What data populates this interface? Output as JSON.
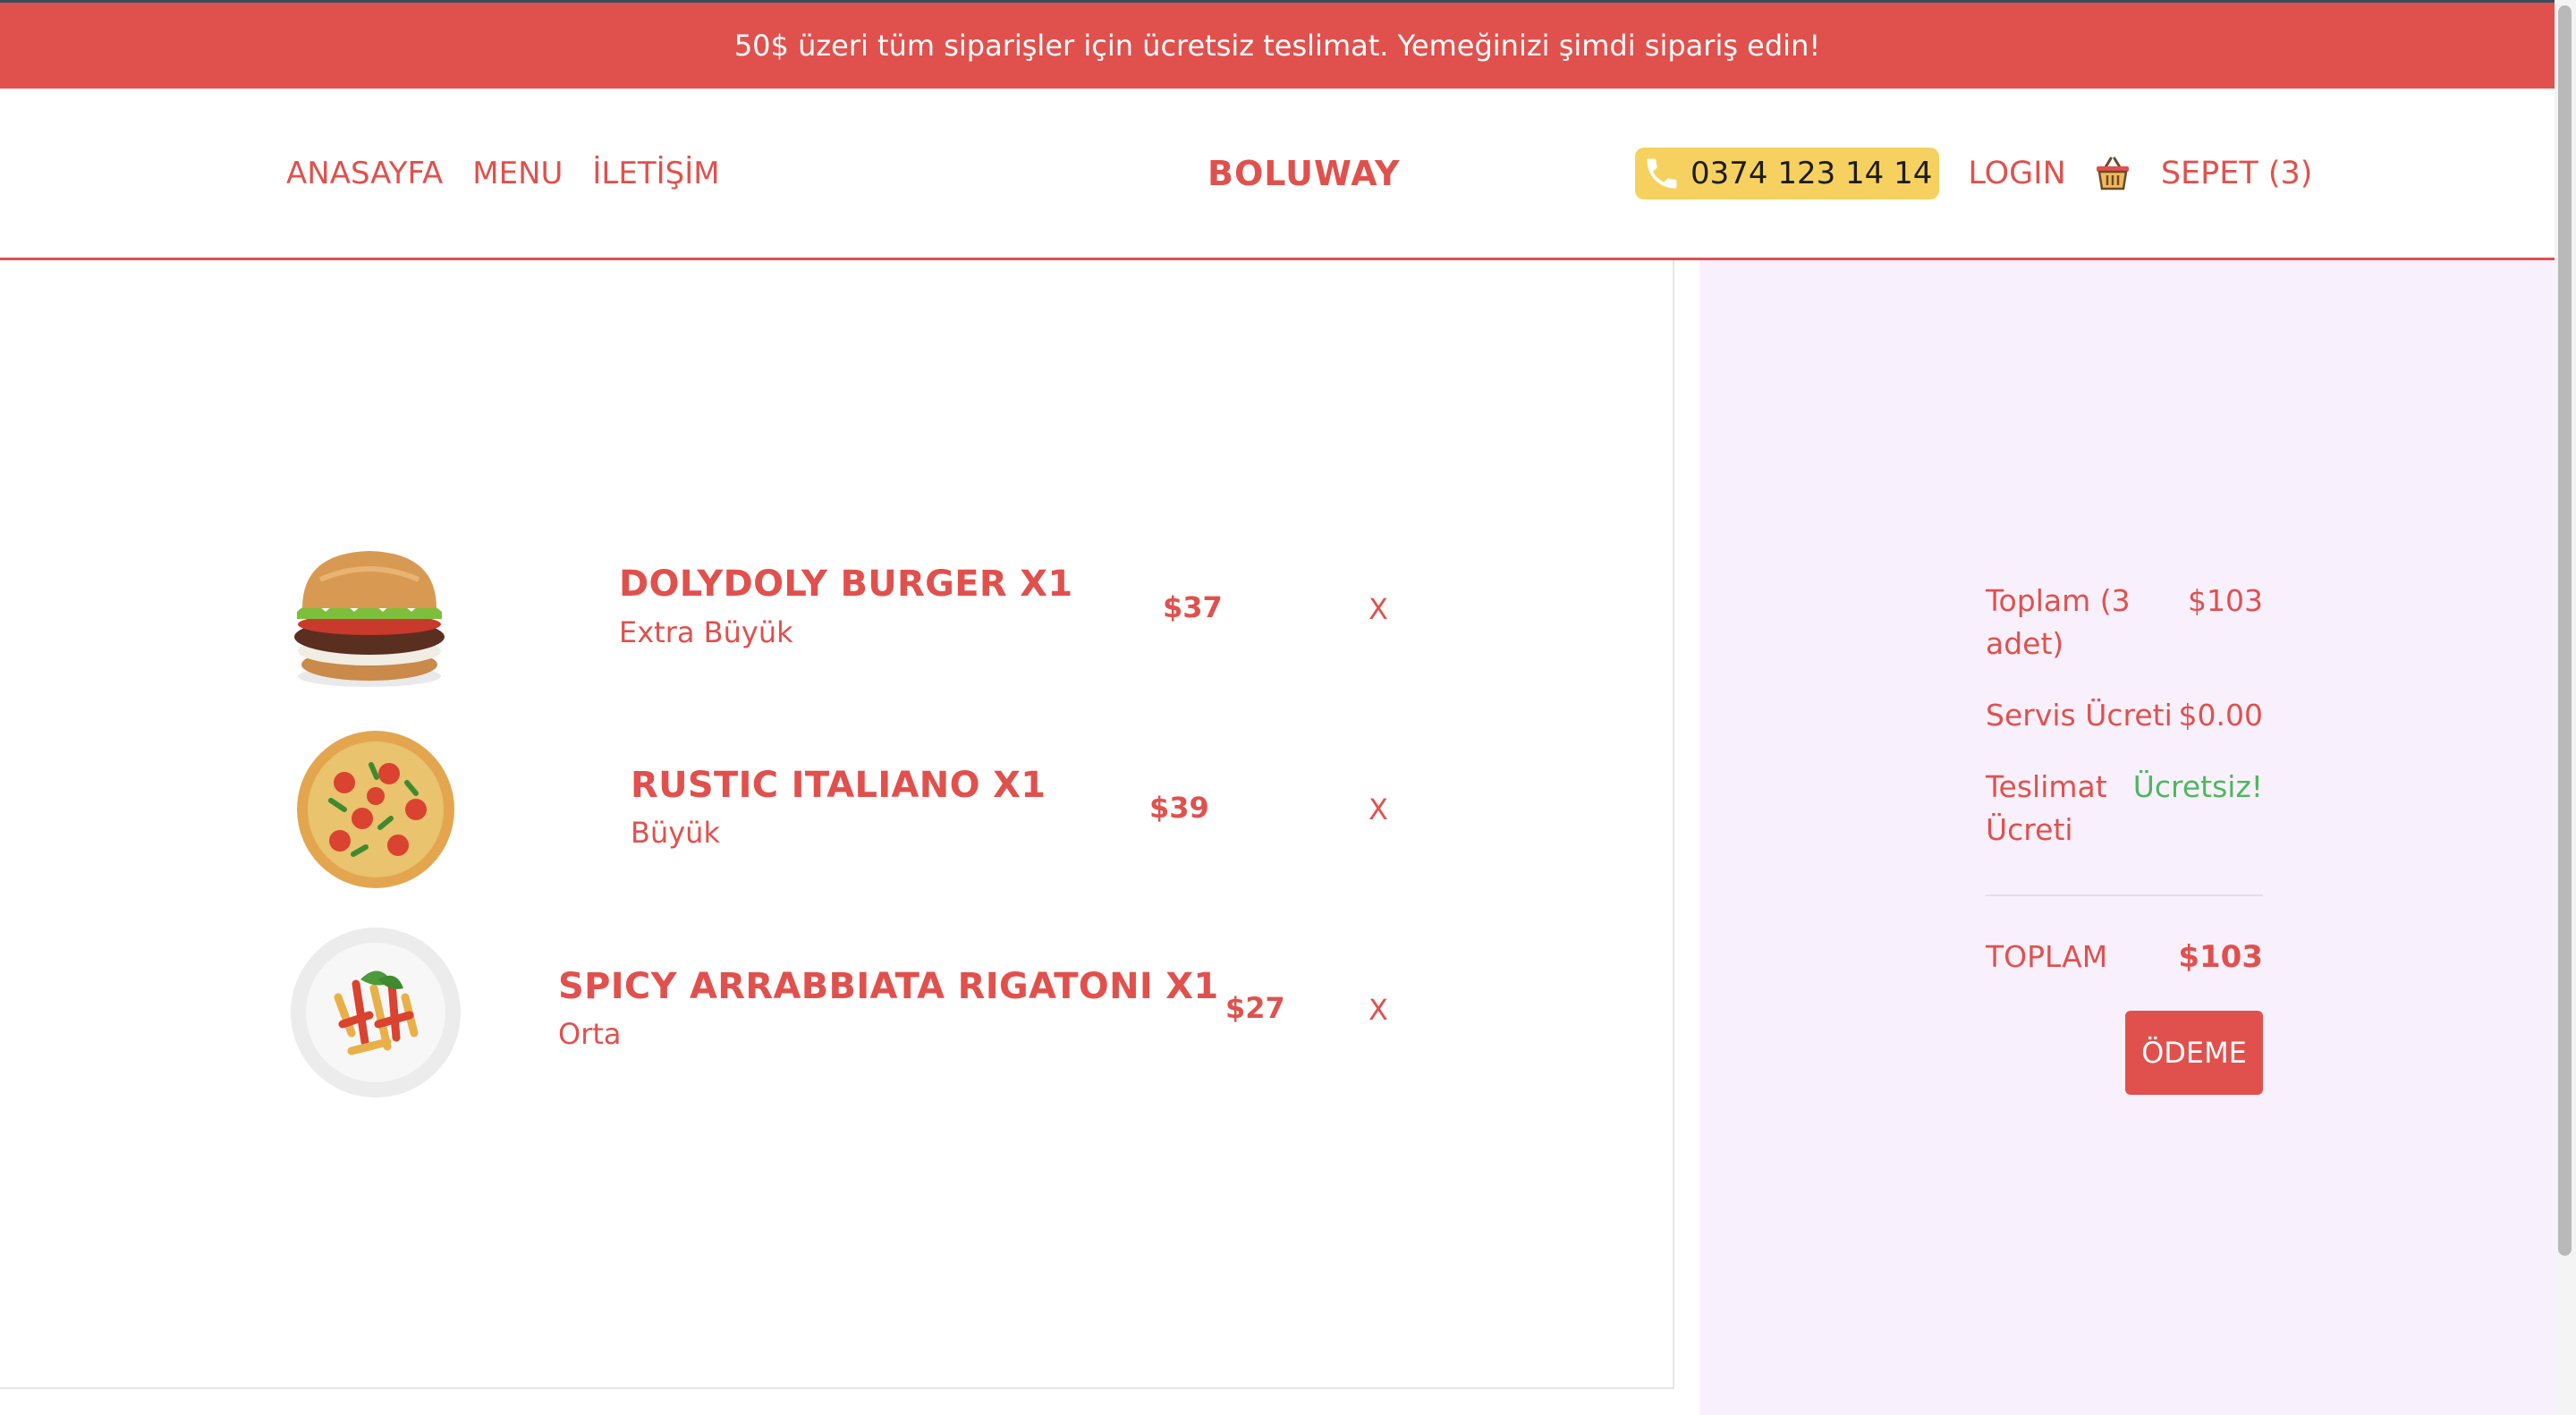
{
  "announcement": "50$ üzeri tüm siparişler için ücretsiz teslimat. Yemeğinizi şimdi sipariş edin!",
  "nav": {
    "home": "ANASAYFA",
    "menu": "MENU",
    "contact": "İLETİŞİM"
  },
  "brand": "BOLUWAY",
  "header_right": {
    "phone": "0374 123 14 14",
    "login": "LOGIN",
    "cart": "SEPET (3)",
    "phone_icon": "phone-icon",
    "basket_icon": "basket-icon"
  },
  "cart": {
    "items": [
      {
        "name": "DOLYDOLY BURGER X1",
        "size": "Extra Büyük",
        "price": "$37",
        "remove": "X",
        "image": "burger-image"
      },
      {
        "name": "RUSTIC ITALIANO X1",
        "size": "Büyük",
        "price": "$39",
        "remove": "X",
        "image": "pizza-image"
      },
      {
        "name": "SPICY ARRABBIATA RIGATONI X1",
        "size": "Orta",
        "price": "$27",
        "remove": "X",
        "image": "pasta-image"
      }
    ]
  },
  "summary": {
    "subtotal_label": "Toplam (3 adet)",
    "subtotal_value": "$103",
    "service_label": "Servis Ücreti",
    "service_value": "$0.00",
    "delivery_label": "Teslimat Ücreti",
    "delivery_value": "Ücretsiz!",
    "total_label": "TOPLAM",
    "total_value": "$103",
    "checkout": "ÖDEME"
  },
  "colors": {
    "accent": "#e0514d",
    "phone_bg": "#f7d15f",
    "summary_bg": "#f9f0fd",
    "free_text": "#4cb85c"
  }
}
